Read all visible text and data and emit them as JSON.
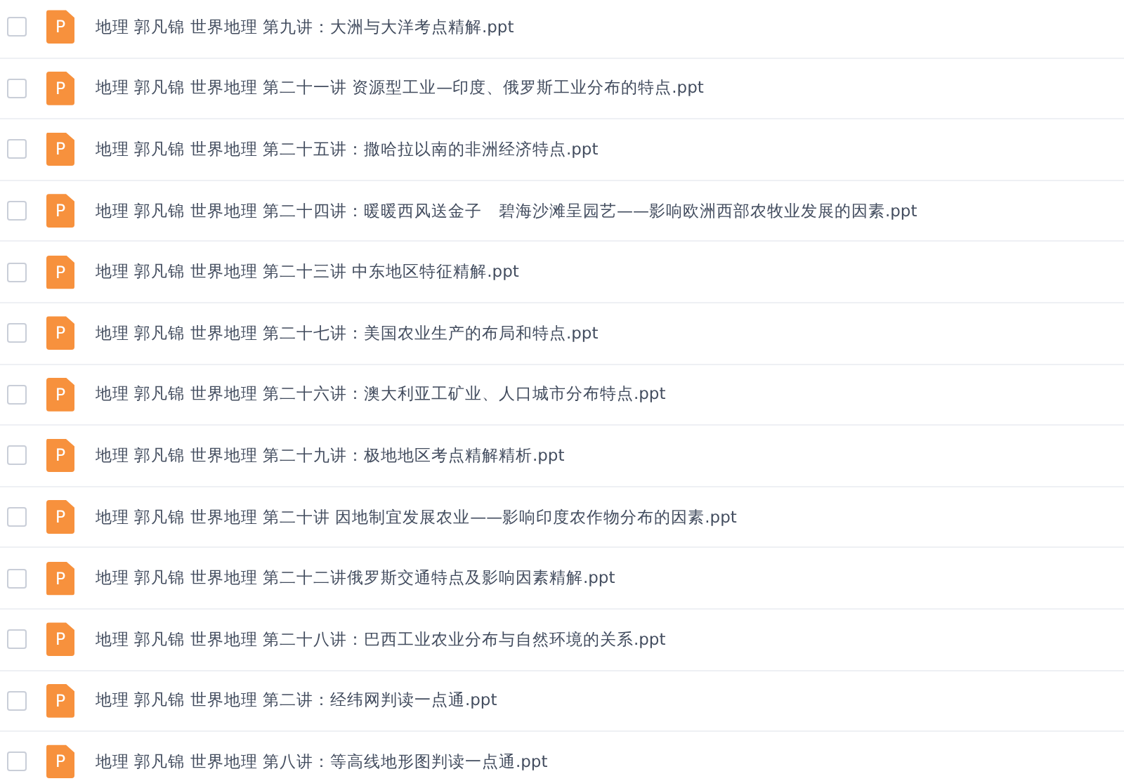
{
  "files": [
    {
      "name": "地理 郭凡锦 世界地理 第九讲：大洲与大洋考点精解.ppt",
      "badge": "P",
      "checked": false
    },
    {
      "name": "地理 郭凡锦 世界地理 第二十一讲 资源型工业—印度、俄罗斯工业分布的特点.ppt",
      "badge": "P",
      "checked": false
    },
    {
      "name": "地理 郭凡锦 世界地理 第二十五讲：撒哈拉以南的非洲经济特点.ppt",
      "badge": "P",
      "checked": false
    },
    {
      "name": "地理 郭凡锦 世界地理 第二十四讲：暖暖西风送金子　碧海沙滩呈园艺——影响欧洲西部农牧业发展的因素.ppt",
      "badge": "P",
      "checked": false
    },
    {
      "name": "地理 郭凡锦 世界地理 第二十三讲 中东地区特征精解.ppt",
      "badge": "P",
      "checked": false
    },
    {
      "name": "地理 郭凡锦 世界地理 第二十七讲：美国农业生产的布局和特点.ppt",
      "badge": "P",
      "checked": false
    },
    {
      "name": "地理 郭凡锦 世界地理 第二十六讲：澳大利亚工矿业、人口城市分布特点.ppt",
      "badge": "P",
      "checked": false
    },
    {
      "name": "地理 郭凡锦 世界地理 第二十九讲：极地地区考点精解精析.ppt",
      "badge": "P",
      "checked": false
    },
    {
      "name": "地理 郭凡锦 世界地理 第二十讲 因地制宜发展农业——影响印度农作物分布的因素.ppt",
      "badge": "P",
      "checked": false
    },
    {
      "name": "地理 郭凡锦 世界地理 第二十二讲俄罗斯交通特点及影响因素精解.ppt",
      "badge": "P",
      "checked": false
    },
    {
      "name": "地理 郭凡锦 世界地理 第二十八讲：巴西工业农业分布与自然环境的关系.ppt",
      "badge": "P",
      "checked": false
    },
    {
      "name": "地理 郭凡锦 世界地理 第二讲：经纬网判读一点通.ppt",
      "badge": "P",
      "checked": false
    },
    {
      "name": "地理 郭凡锦 世界地理 第八讲：等高线地形图判读一点通.ppt",
      "badge": "P",
      "checked": false
    }
  ]
}
